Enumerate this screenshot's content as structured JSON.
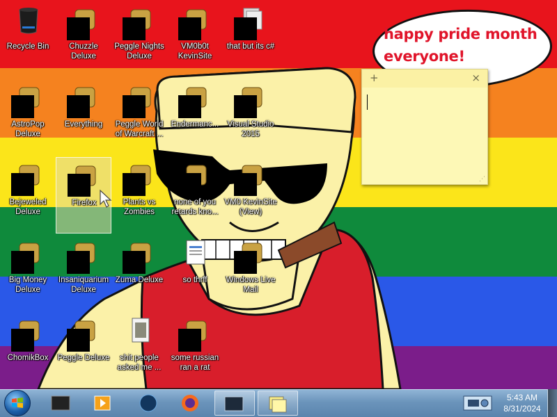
{
  "wallpaper": {
    "stripe_colors": [
      "#e8141c",
      "#f5821f",
      "#fbe51a",
      "#0f8a3c",
      "#2a58e8",
      "#7b1d8a"
    ],
    "bubble_text": "happy pride month everyone!"
  },
  "sticky_note": {
    "add_glyph": "+",
    "close_glyph": "×",
    "text": ""
  },
  "desktop_icons": [
    {
      "label": "Recycle Bin",
      "icon": "recycle-bin-icon",
      "redacted": false
    },
    {
      "label": "Chuzzle Deluxe",
      "icon": "chuzzle-icon",
      "redacted": true
    },
    {
      "label": "Peggle Nights Deluxe",
      "icon": "peggle-nights-icon",
      "redacted": true
    },
    {
      "label": "VM0b0t KevinSite",
      "icon": "vm0b0t-icon",
      "redacted": true
    },
    {
      "label": "that but its c#",
      "icon": "folder-icon",
      "redacted": true
    },
    {
      "label": "AstroPop Deluxe",
      "icon": "astropop-icon",
      "redacted": true
    },
    {
      "label": "Everything",
      "icon": "everything-icon",
      "redacted": true
    },
    {
      "label": "Peggle World of Warcraft ...",
      "icon": "peggle-wow-icon",
      "redacted": true
    },
    {
      "label": "Endermanc...",
      "icon": "enderman-icon",
      "redacted": true
    },
    {
      "label": "Visual Studio 2015",
      "icon": "visual-studio-icon",
      "redacted": true
    },
    {
      "label": "Bejeweled Deluxe",
      "icon": "bejeweled-icon",
      "redacted": true
    },
    {
      "label": "Firefox",
      "icon": "firefox-icon",
      "redacted": true
    },
    {
      "label": "Plants vs Zombies",
      "icon": "plants-vs-zombies-icon",
      "redacted": true
    },
    {
      "label": "none of you retards kno...",
      "icon": "app-icon",
      "redacted": true
    },
    {
      "label": "VM0 KevinSite (View)",
      "icon": "visual-studio-icon",
      "redacted": true
    },
    {
      "label": "Big Money Deluxe",
      "icon": "big-money-icon",
      "redacted": true
    },
    {
      "label": "Insaniquarium Deluxe",
      "icon": "insaniquarium-icon",
      "redacted": true
    },
    {
      "label": "Zuma Deluxe",
      "icon": "zuma-icon",
      "redacted": true
    },
    {
      "label": "so thrff",
      "icon": "document-icon",
      "redacted": false
    },
    {
      "label": "Windows Live Mail",
      "icon": "mail-icon",
      "redacted": true
    },
    {
      "label": "ChomikBox",
      "icon": "chomikbox-icon",
      "redacted": true
    },
    {
      "label": "Peggle Deluxe",
      "icon": "peggle-icon",
      "redacted": true
    },
    {
      "label": "shit people asked me ...",
      "icon": "text-file-icon",
      "redacted": false
    },
    {
      "label": "some russian ran a rat",
      "icon": "illustrator-file-icon",
      "redacted": true
    }
  ],
  "taskbar": {
    "pinned": [
      {
        "name": "taskbar-explorer",
        "icon": "library-icon",
        "active": false
      },
      {
        "name": "taskbar-media-player",
        "icon": "media-player-icon",
        "active": false
      },
      {
        "name": "taskbar-vm",
        "icon": "globe-icon",
        "active": false
      },
      {
        "name": "taskbar-firefox",
        "icon": "firefox-icon",
        "active": false
      },
      {
        "name": "taskbar-window",
        "icon": "window-icon",
        "active": true
      },
      {
        "name": "taskbar-sticky-notes",
        "icon": "sticky-notes-icon",
        "active": true
      }
    ],
    "clock_time": "5:43 AM",
    "clock_date": "8/31/2024"
  }
}
